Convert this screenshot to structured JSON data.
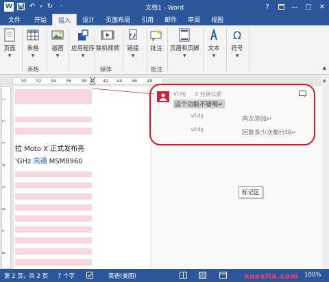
{
  "title_bar": {
    "title": "文档1 - Word",
    "controls": [
      "?",
      "□",
      "—",
      "□",
      "✕"
    ]
  },
  "tabs": [
    "文件",
    "开始",
    "插入",
    "设计",
    "页面布局",
    "引用",
    "邮件",
    "审阅",
    "视图"
  ],
  "active_tab": "插入",
  "ribbon": {
    "buttons": [
      {
        "label": "页面",
        "icon": "page-icon"
      },
      {
        "label": "表格",
        "icon": "table-icon"
      },
      {
        "label": "插图",
        "icon": "picture-icon"
      },
      {
        "label": "应用程序",
        "icon": "apps-icon"
      },
      {
        "label": "联机视频",
        "icon": "video-icon"
      },
      {
        "label": "链接",
        "icon": "link-icon"
      },
      {
        "label": "批注",
        "icon": "comment-icon"
      },
      {
        "label": "页眉和页脚",
        "icon": "header-footer-icon"
      },
      {
        "label": "文本",
        "icon": "text-icon"
      },
      {
        "label": "符号",
        "icon": "symbol-icon"
      }
    ],
    "groups": [
      "表格",
      "媒体",
      "批注"
    ]
  },
  "ruler": {
    "numbers": [
      "30",
      "32",
      "34",
      "36",
      "38",
      "40",
      "42",
      "44",
      "46",
      "48"
    ],
    "vertical_numbers": [
      "1",
      "2",
      "3",
      "4",
      "5",
      "6",
      "7",
      "8"
    ]
  },
  "document": {
    "line1_a": "拉 Moto X 正式发布亮",
    "line2_a": "'GHz ",
    "line2_b": "高通",
    "line2_c": " MSM8960"
  },
  "comment": {
    "author": "wldg",
    "time": "3 分钟以前",
    "text": "这个功能不错啊↵",
    "replies": [
      {
        "author": "wldg",
        "text": "再次添加↵"
      },
      {
        "author": "wldg",
        "text": "回复多少次都行吗↵"
      }
    ]
  },
  "mark_area_label": "标记区",
  "status": {
    "page": "第 2 页，共 2 页",
    "words": "7 个字",
    "language": "英语(美国)",
    "zoom": "100%"
  },
  "watermark": "xuexila.com",
  "colors": {
    "accent": "#2b579a",
    "highlight_pink": "#f6d7df",
    "oval_red": "#c8202b"
  }
}
